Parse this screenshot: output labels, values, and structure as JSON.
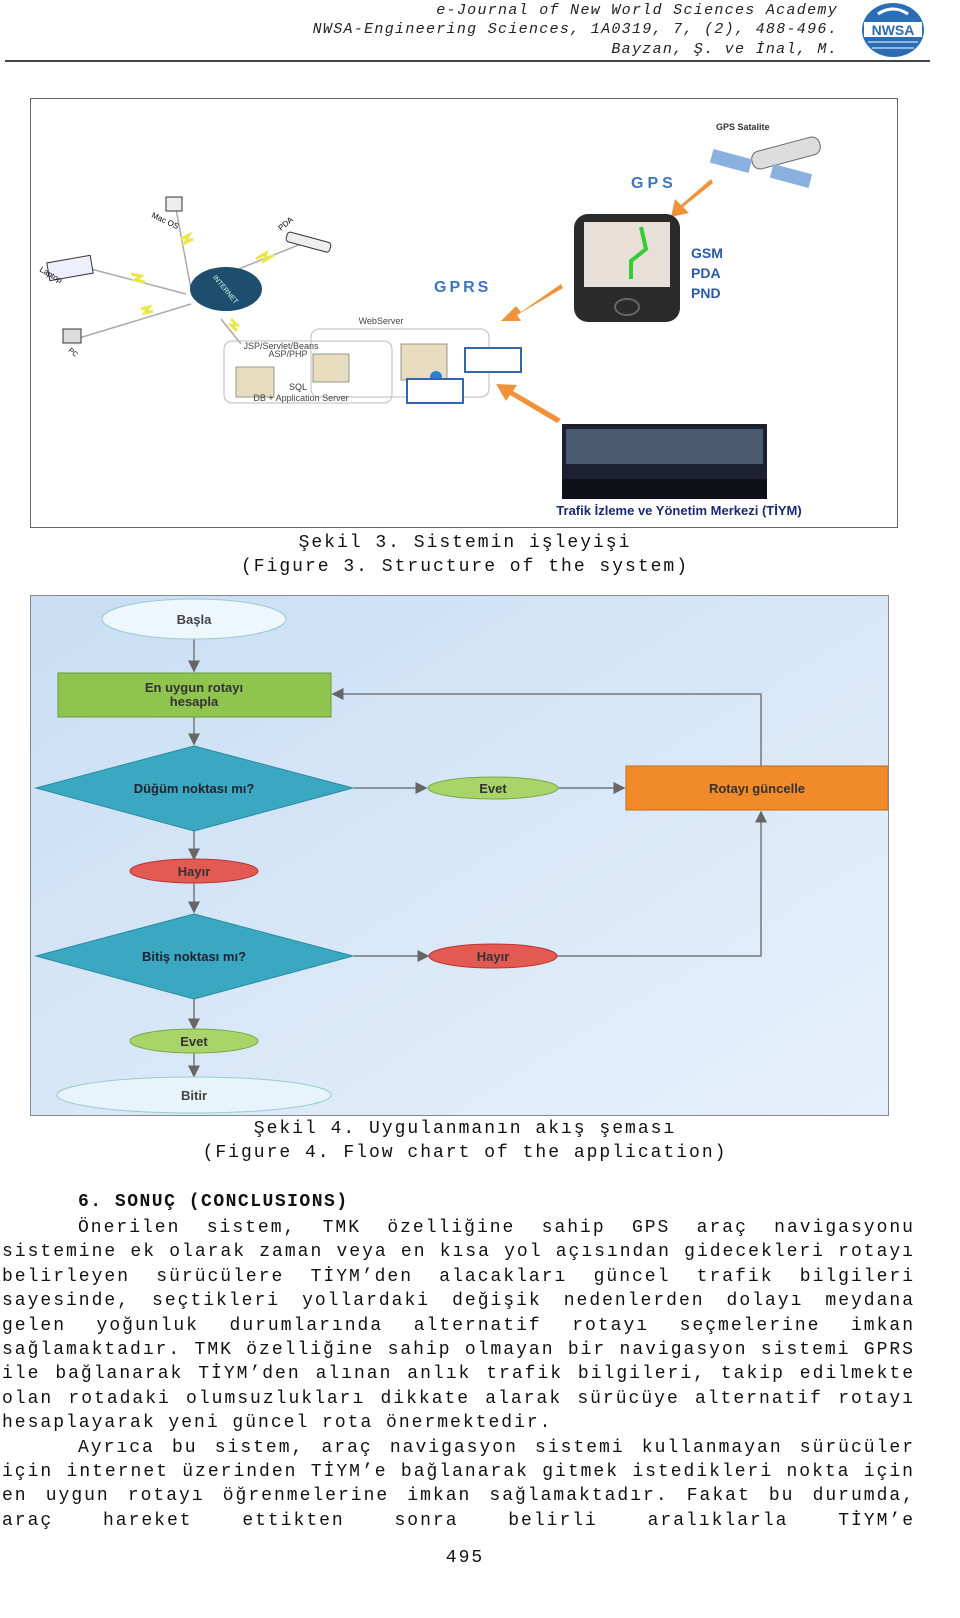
{
  "header": {
    "journal": "e-Journal of New World Sciences Academy",
    "citation": "NWSA-Engineering Sciences, 1A0319, 7, (2), 488-496.",
    "authors": "Bayzan, Ş. ve İnal, M.",
    "logo_text": "NWSA"
  },
  "figure3": {
    "labels": {
      "mac": "Mac OS",
      "pda": "PDA",
      "laptop": "Laptop",
      "pc": "PC",
      "internet": "INTERNET",
      "webserver": "WebServer",
      "jsp": "JSP/Servlet/Beans",
      "asp": "ASP/PHP",
      "sql": "SQL",
      "dbserver": "DB + Application Server",
      "gprs": "GPRS",
      "gps": "GPS",
      "satellite": "GPS Satalite",
      "gsm": "GSM",
      "pda2": "PDA",
      "pnd": "PND",
      "center": "Trafik İzleme ve Yönetim Merkezi (TİYM)"
    },
    "caption_tr": "Şekil 3. Sistemin işleyişi",
    "caption_en": "(Figure 3. Structure of the system)"
  },
  "figure4": {
    "nodes": {
      "start": "Başla",
      "compute": "En uygun rotayı hesapla",
      "compute_l1": "En uygun rotayı",
      "compute_l2": "hesapla",
      "node_q": "Düğüm noktası mı?",
      "yes1": "Evet",
      "update": "Rotayı güncelle",
      "no1": "Hayır",
      "end_q": "Bitiş noktası mı?",
      "no2": "Hayır",
      "yes2": "Evet",
      "end": "Bitir"
    },
    "colors": {
      "green": "#8fc44f",
      "orange": "#f08a2a",
      "red": "#e25a52",
      "teal": "#3aa8c0",
      "ellipse": "#e8f4fb"
    },
    "caption_tr": "Şekil 4. Uygulanmanın akış şeması",
    "caption_en": "(Figure 4. Flow chart of the application)"
  },
  "section": {
    "heading": "6. SONUÇ (CONCLUSIONS)",
    "paragraphs": [
      "Önerilen sistem, TMK özelliğine sahip GPS araç navigasyonu sistemine ek olarak zaman veya en kısa yol açısından gidecekleri rotayı belirleyen sürücülere TİYM’den alacakları güncel trafik bilgileri sayesinde, seçtikleri yollardaki değişik nedenlerden dolayı meydana gelen yoğunluk durumlarında alternatif rotayı seçmelerine imkan sağlamaktadır. TMK özelliğine sahip olmayan bir navigasyon sistemi GPRS ile bağlanarak TİYM’den alınan anlık trafik bilgileri, takip edilmekte olan rotadaki olumsuzlukları dikkate alarak sürücüye alternatif rotayı hesaplayarak yeni güncel rota önermektedir.",
      "Ayrıca bu sistem, araç navigasyon sistemi kullanmayan sürücüler için internet üzerinden TİYM’e bağlanarak gitmek istedikleri nokta için en uygun rotayı öğrenmelerine imkan sağlamaktadır. Fakat bu durumda, araç hareket ettikten sonra belirli aralıklarla TİYM’e"
    ]
  },
  "page_number": "495"
}
